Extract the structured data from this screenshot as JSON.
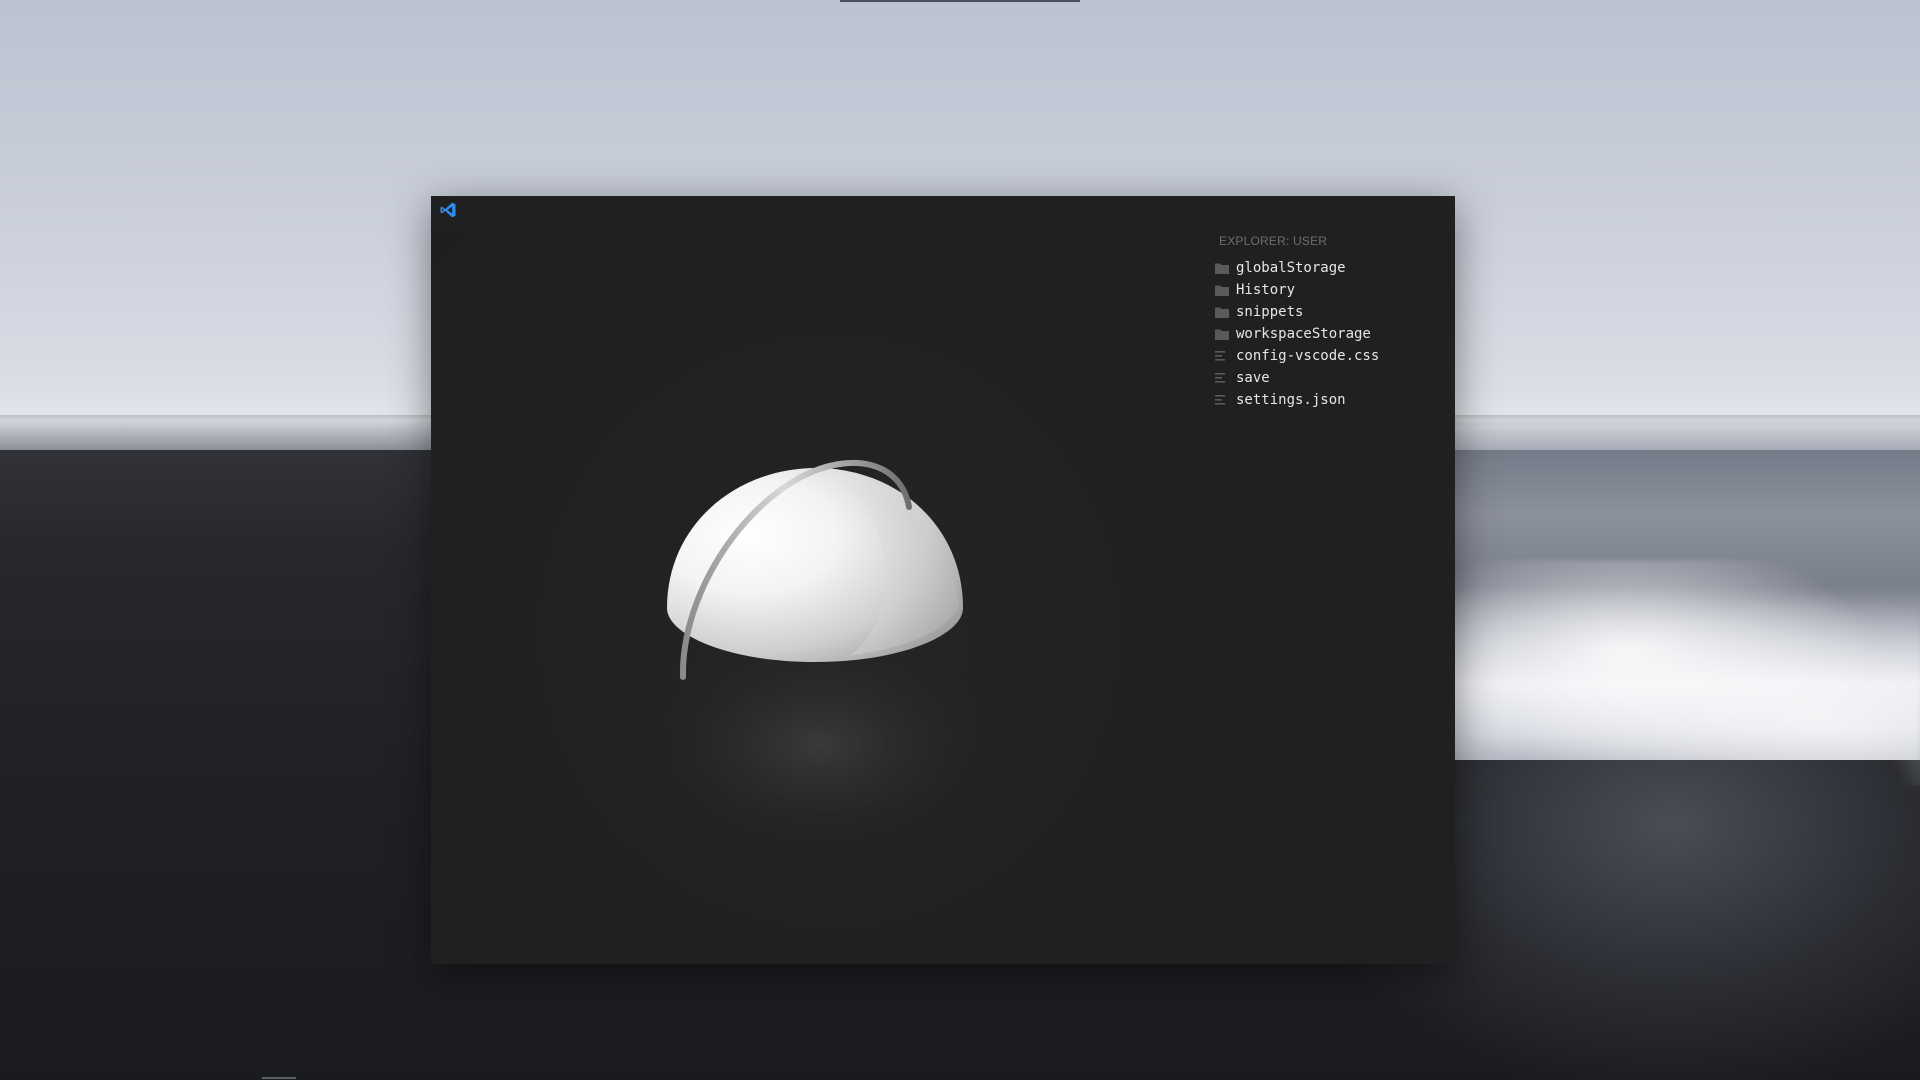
{
  "desktop": {
    "wallpaper": "foggy-black-sand-beach"
  },
  "window": {
    "app_icon": "vscode-logo-icon",
    "accent_color": "#2f8ded",
    "background_color": "#202020"
  },
  "explorer": {
    "title": "EXPLORER: USER",
    "items": [
      {
        "label": "globalStorage",
        "type": "folder",
        "icon": "folder-icon"
      },
      {
        "label": "History",
        "type": "folder",
        "icon": "folder-icon"
      },
      {
        "label": "snippets",
        "type": "folder",
        "icon": "folder-icon"
      },
      {
        "label": "workspaceStorage",
        "type": "folder",
        "icon": "folder-icon"
      },
      {
        "label": "config-vscode.css",
        "type": "file",
        "icon": "file-lines-icon"
      },
      {
        "label": "save",
        "type": "file",
        "icon": "file-lines-icon"
      },
      {
        "label": "settings.json",
        "type": "file",
        "icon": "file-lines-icon"
      }
    ]
  },
  "editor": {
    "watermark": "vscode-3d-logo-hemisphere"
  }
}
